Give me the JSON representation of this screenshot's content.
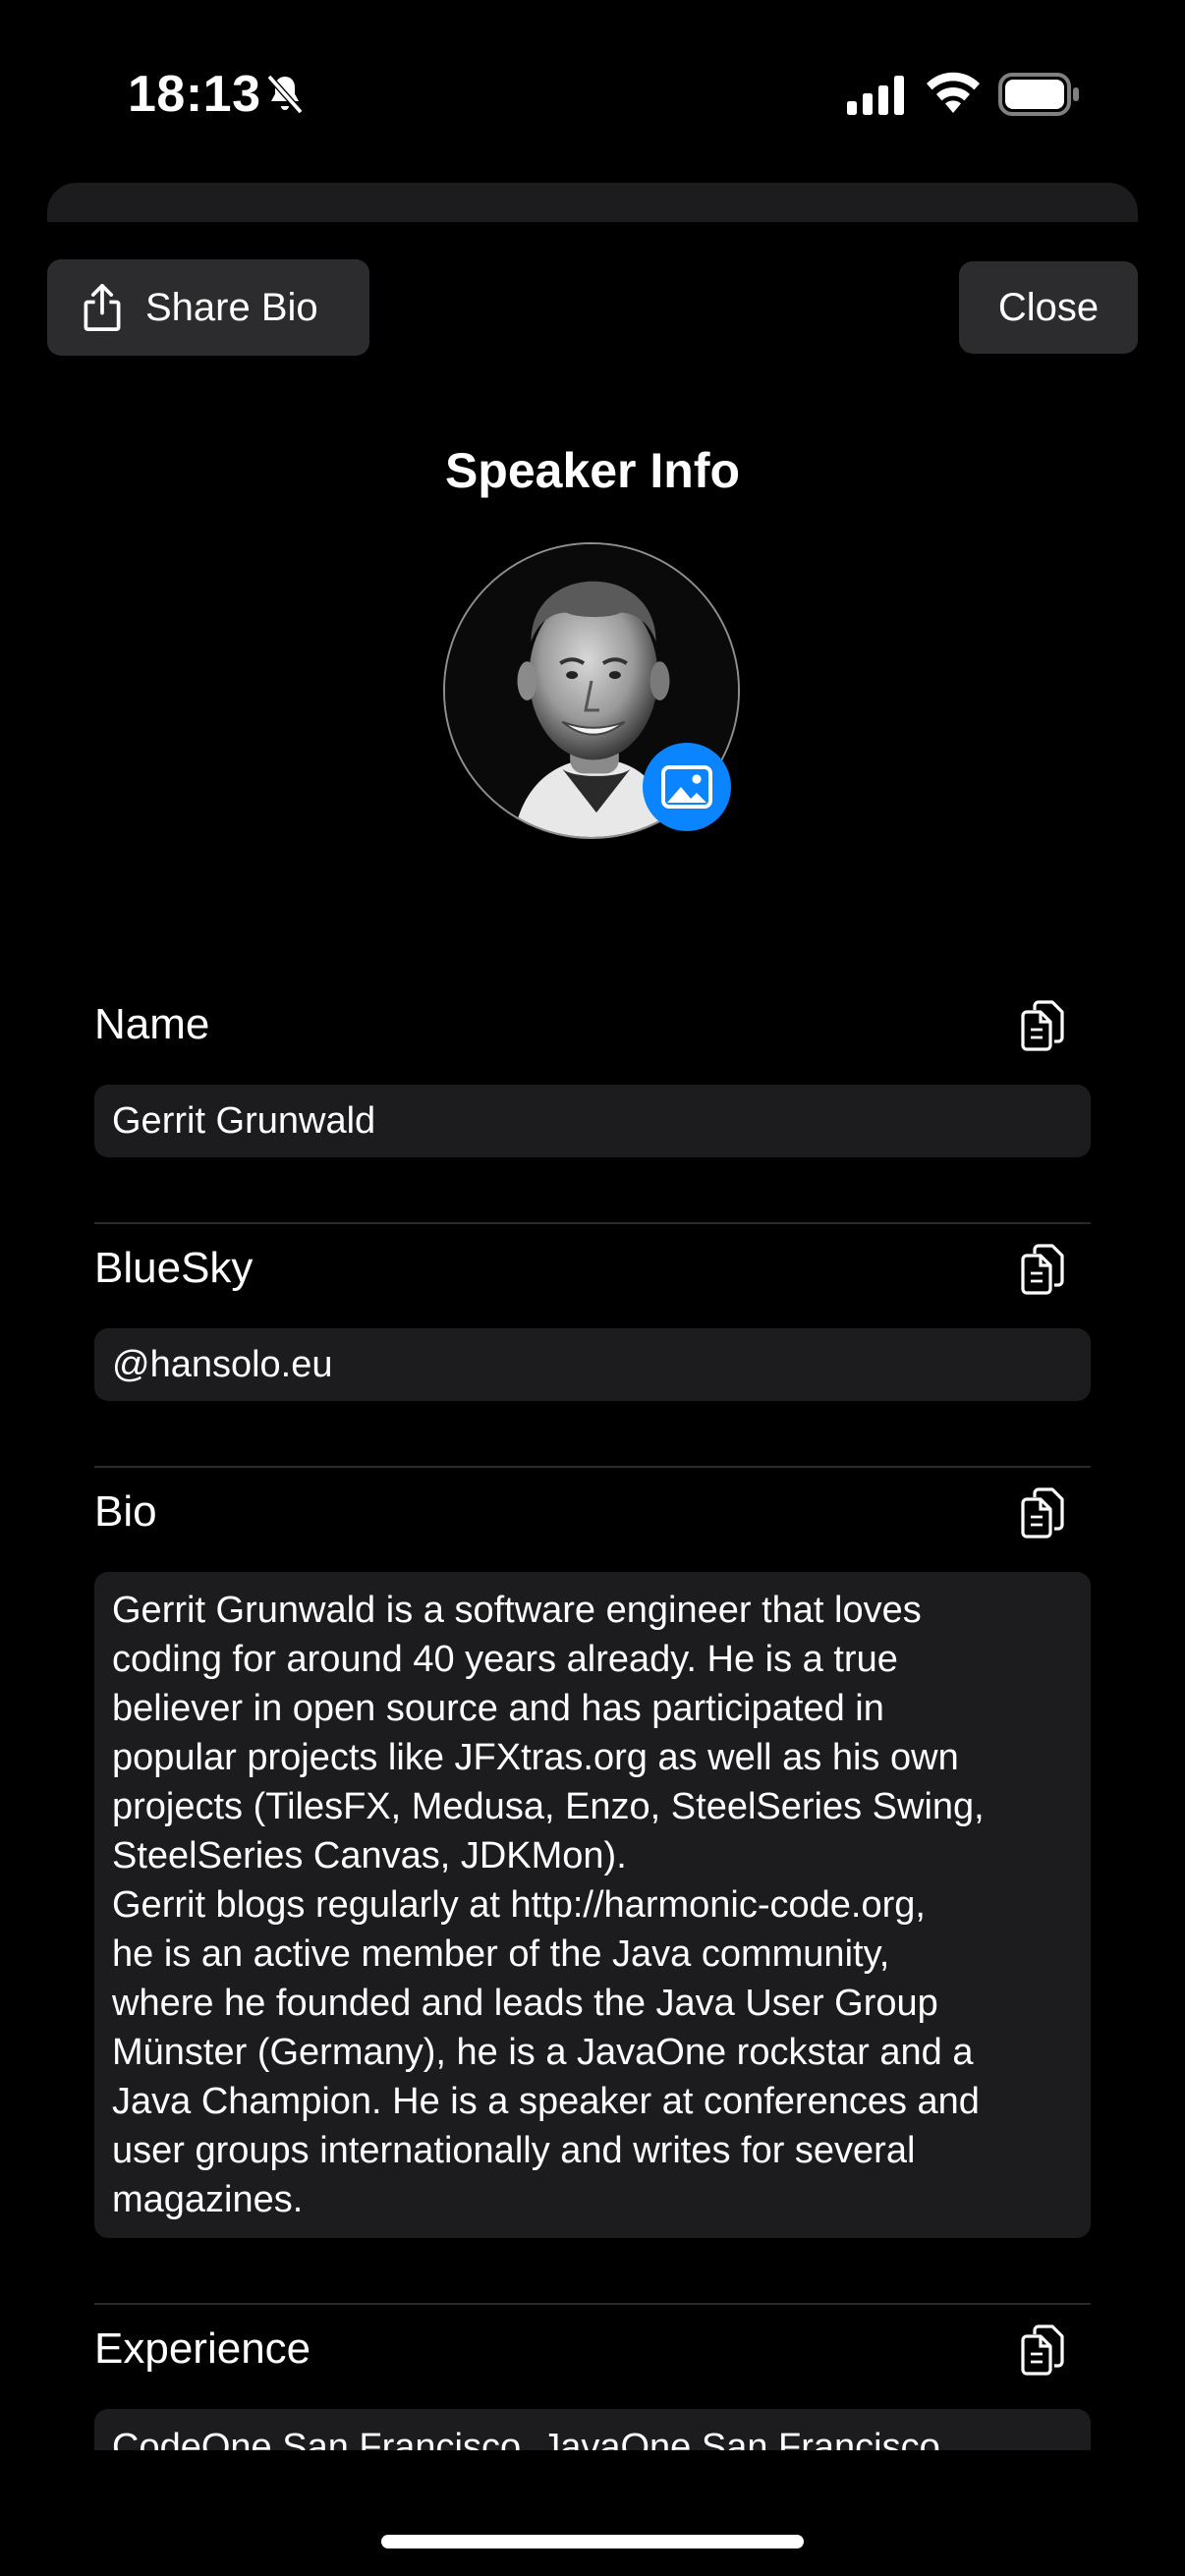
{
  "status_bar": {
    "time": "18:13"
  },
  "toolbar": {
    "share_label": "Share Bio",
    "close_label": "Close"
  },
  "sheet_title": "Speaker Info",
  "fields": {
    "name": {
      "label": "Name",
      "value": "Gerrit Grunwald"
    },
    "bluesky": {
      "label": "BlueSky",
      "value": "@hansolo.eu"
    },
    "bio": {
      "label": "Bio",
      "value": "Gerrit Grunwald is a software engineer that loves\ncoding for around 40 years already. He is a true\nbeliever in open source and has participated in\npopular projects like JFXtras.org as well as his own\nprojects (TilesFX, Medusa, Enzo, SteelSeries Swing,\nSteelSeries Canvas, JDKMon).\nGerrit blogs regularly at http://harmonic-code.org,\nhe is an active member of the Java community,\nwhere he founded and leads the Java User Group\nMünster (Germany), he is a JavaOne rockstar and a\nJava Champion. He is a speaker at conferences and\nuser groups internationally and writes for several\nmagazines."
    },
    "experience": {
      "label": "Experience",
      "value": "CodeOne San Francisco, JavaOne San Francisco,"
    }
  },
  "icons": {
    "share": "share-icon",
    "copy": "copy-icon",
    "photo": "photo-icon",
    "bell_slash": "bell-slash-icon"
  },
  "colors": {
    "background": "#000000",
    "surface": "#1c1c1e",
    "button": "#2c2c2e",
    "accent": "#0a84ff"
  }
}
